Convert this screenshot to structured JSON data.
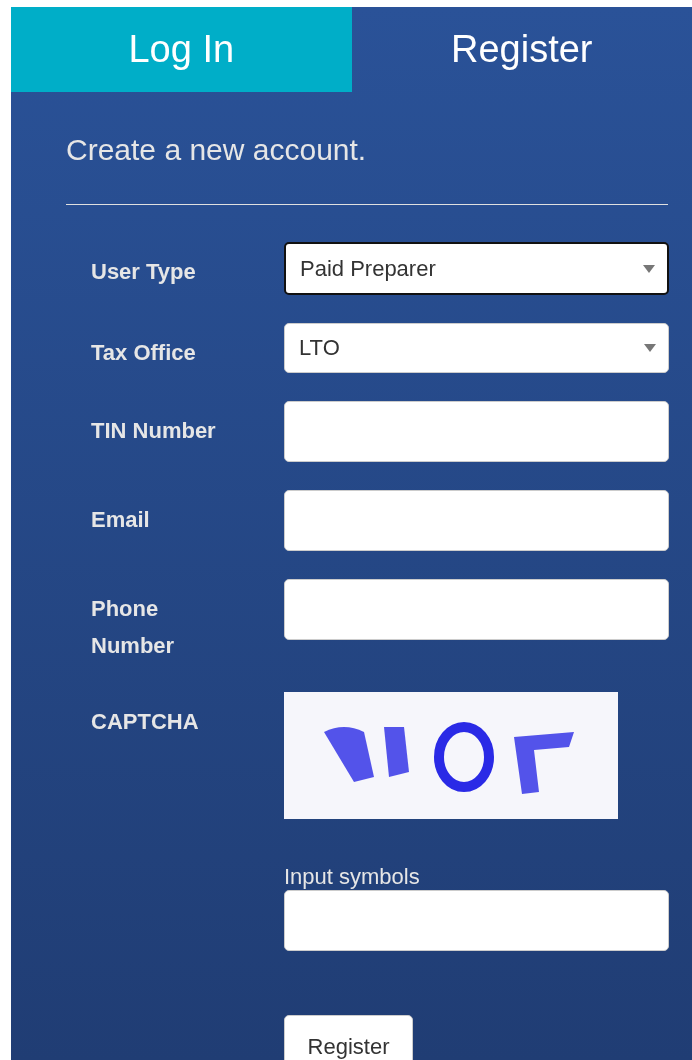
{
  "tabs": [
    {
      "label": "Log In",
      "selected": false
    },
    {
      "label": "Register",
      "selected": true
    }
  ],
  "heading": "Create a new account.",
  "fields": [
    {
      "label": "User Type",
      "kind": "select",
      "value": "Paid Preparer",
      "focused": true
    },
    {
      "label": "Tax Office",
      "kind": "select",
      "value": "LTO",
      "focused": false
    },
    {
      "label": "TIN Number",
      "kind": "text",
      "focused": false
    },
    {
      "label": "Email",
      "kind": "text",
      "focused": false
    },
    {
      "label": "Phone Number",
      "kind": "text",
      "focused": false
    }
  ],
  "captcha": {
    "label": "CAPTCHA",
    "input_label": "Input symbols"
  },
  "submit": "Register"
}
